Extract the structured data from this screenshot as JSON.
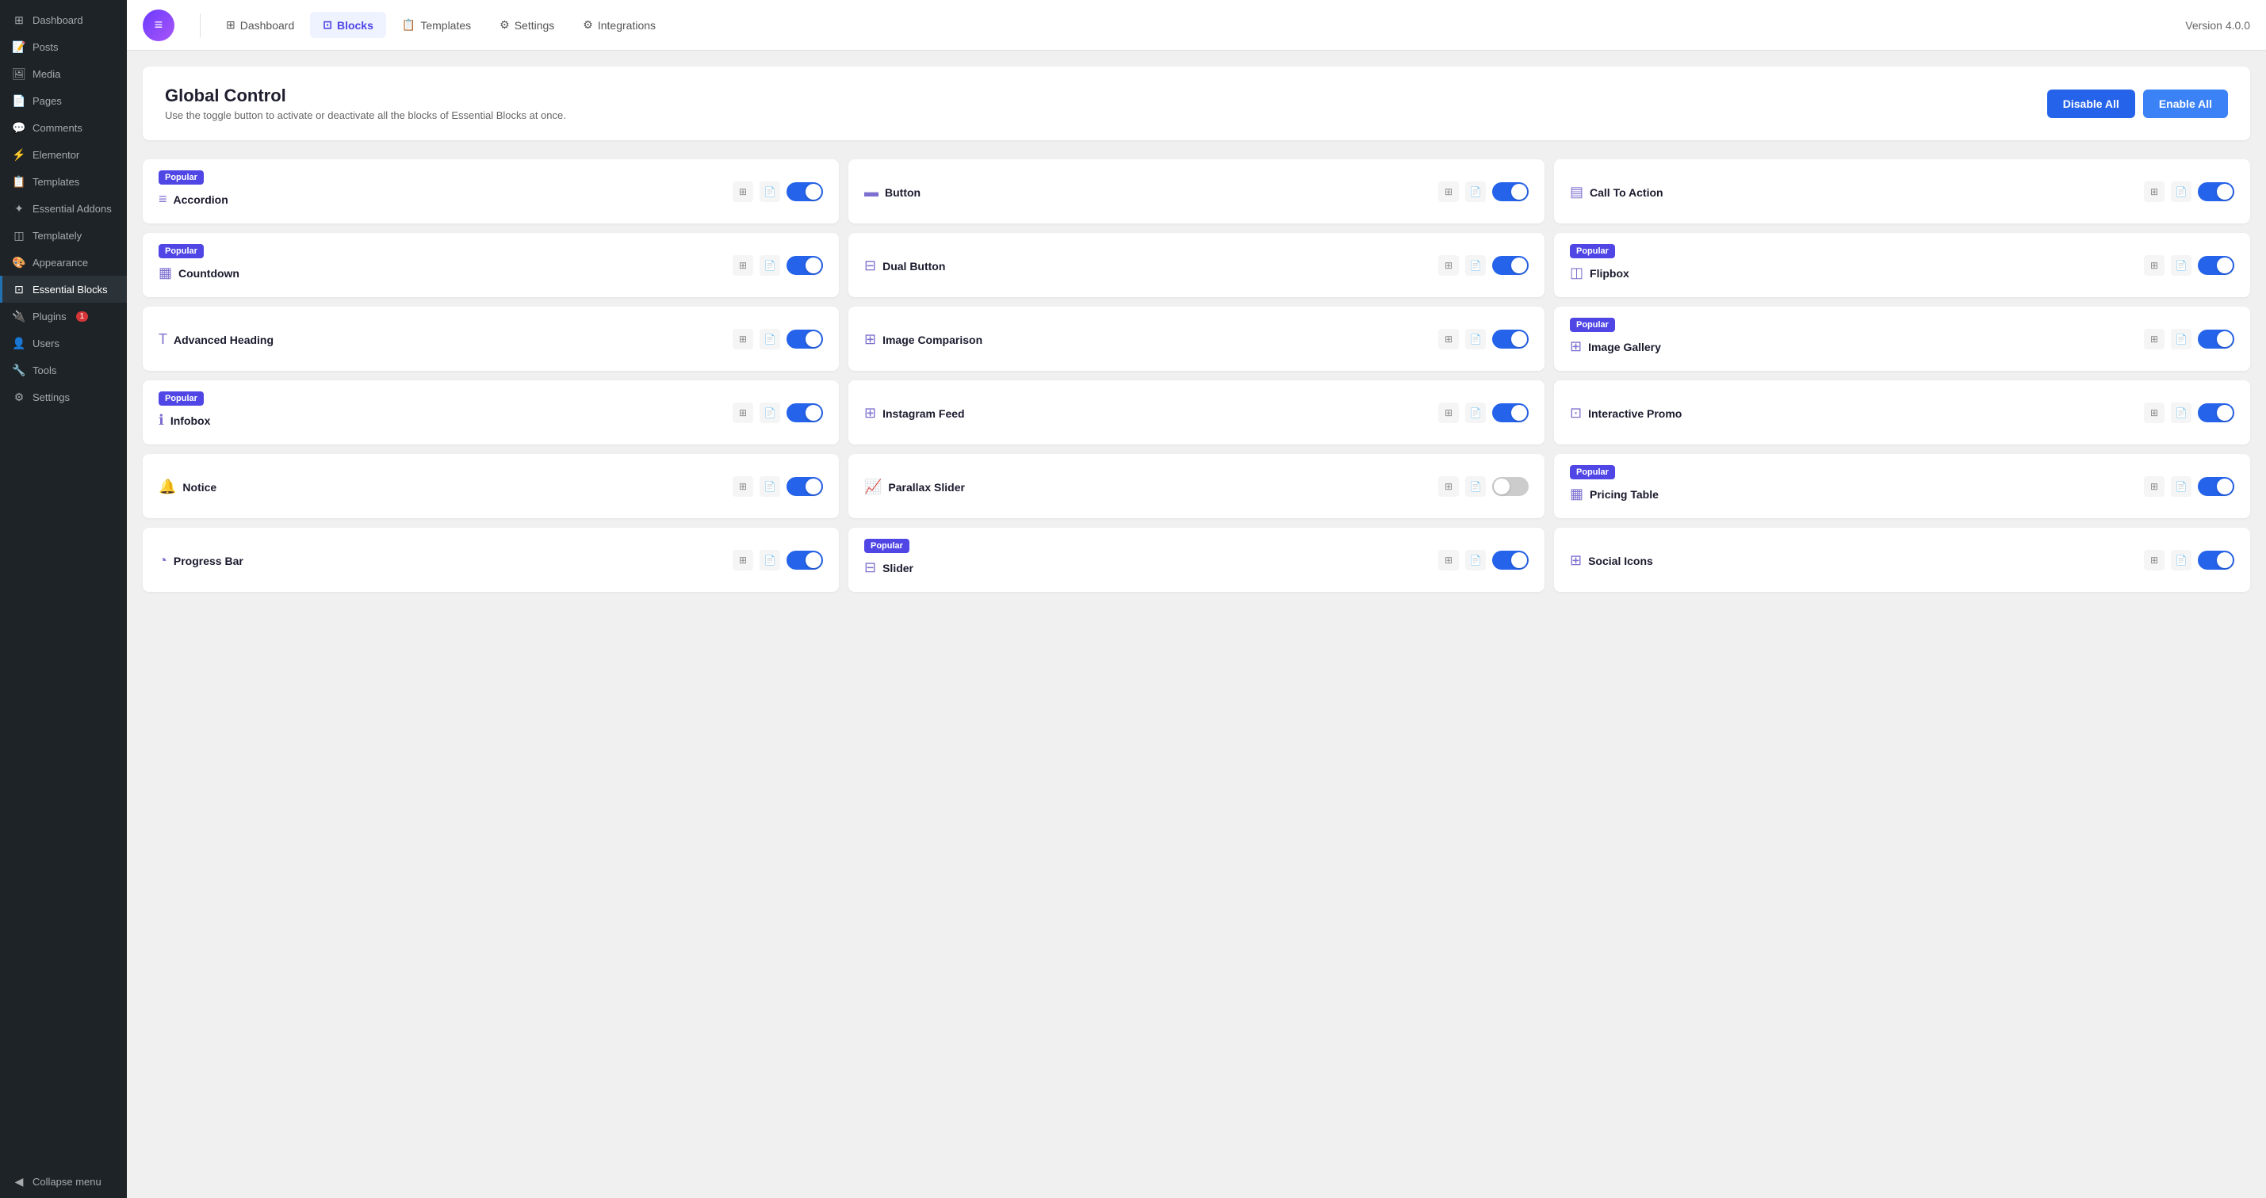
{
  "sidebar": {
    "items": [
      {
        "id": "dashboard",
        "label": "Dashboard",
        "icon": "⊞",
        "active": false
      },
      {
        "id": "posts",
        "label": "Posts",
        "icon": "📝",
        "active": false
      },
      {
        "id": "media",
        "label": "Media",
        "icon": "🖼",
        "active": false
      },
      {
        "id": "pages",
        "label": "Pages",
        "icon": "📄",
        "active": false
      },
      {
        "id": "comments",
        "label": "Comments",
        "icon": "💬",
        "active": false
      },
      {
        "id": "elementor",
        "label": "Elementor",
        "icon": "⚡",
        "active": false
      },
      {
        "id": "templates",
        "label": "Templates",
        "icon": "📋",
        "active": false
      },
      {
        "id": "essential-addons",
        "label": "Essential Addons",
        "icon": "✦",
        "active": false
      },
      {
        "id": "templately",
        "label": "Templately",
        "icon": "◫",
        "active": false
      },
      {
        "id": "appearance",
        "label": "Appearance",
        "icon": "🎨",
        "active": false
      },
      {
        "id": "essential-blocks",
        "label": "Essential Blocks",
        "icon": "⊡",
        "active": true
      },
      {
        "id": "plugins",
        "label": "Plugins",
        "icon": "🔌",
        "active": false,
        "badge": "1"
      },
      {
        "id": "users",
        "label": "Users",
        "icon": "👤",
        "active": false
      },
      {
        "id": "tools",
        "label": "Tools",
        "icon": "🔧",
        "active": false
      },
      {
        "id": "settings",
        "label": "Settings",
        "icon": "⚙",
        "active": false
      }
    ],
    "collapse_label": "Collapse menu"
  },
  "topnav": {
    "logo_icon": "≡",
    "tabs": [
      {
        "id": "dashboard",
        "label": "Dashboard",
        "icon": "⊞",
        "active": false
      },
      {
        "id": "blocks",
        "label": "Blocks",
        "icon": "⊡",
        "active": true
      },
      {
        "id": "templates",
        "label": "Templates",
        "icon": "📋",
        "active": false
      },
      {
        "id": "settings",
        "label": "Settings",
        "icon": "⚙",
        "active": false
      },
      {
        "id": "integrations",
        "label": "Integrations",
        "icon": "⚙",
        "active": false
      }
    ],
    "version": "Version 4.0.0"
  },
  "global_control": {
    "title": "Global Control",
    "description": "Use the toggle button to activate or deactivate all the blocks of Essential Blocks at once.",
    "disable_label": "Disable All",
    "enable_label": "Enable All"
  },
  "blocks": [
    {
      "id": "accordion",
      "name": "Accordion",
      "icon": "≡",
      "popular": true,
      "enabled": true
    },
    {
      "id": "button",
      "name": "Button",
      "icon": "▬",
      "popular": false,
      "enabled": true
    },
    {
      "id": "call-to-action",
      "name": "Call To Action",
      "icon": "▤",
      "popular": false,
      "enabled": true
    },
    {
      "id": "countdown",
      "name": "Countdown",
      "icon": "▦",
      "popular": true,
      "enabled": true
    },
    {
      "id": "dual-button",
      "name": "Dual Button",
      "icon": "⊟",
      "popular": false,
      "enabled": true
    },
    {
      "id": "flipbox",
      "name": "Flipbox",
      "icon": "◫",
      "popular": true,
      "enabled": true
    },
    {
      "id": "advanced-heading",
      "name": "Advanced Heading",
      "icon": "T",
      "popular": false,
      "enabled": true
    },
    {
      "id": "image-comparison",
      "name": "Image Comparison",
      "icon": "⊞",
      "popular": false,
      "enabled": true
    },
    {
      "id": "image-gallery",
      "name": "Image Gallery",
      "icon": "⊞",
      "popular": true,
      "enabled": true
    },
    {
      "id": "infobox",
      "name": "Infobox",
      "icon": "ℹ",
      "popular": true,
      "enabled": true
    },
    {
      "id": "instagram-feed",
      "name": "Instagram Feed",
      "icon": "⊞",
      "popular": false,
      "enabled": true
    },
    {
      "id": "interactive-promo",
      "name": "Interactive Promo",
      "icon": "⊡",
      "popular": false,
      "enabled": true
    },
    {
      "id": "notice",
      "name": "Notice",
      "icon": "🔔",
      "popular": false,
      "enabled": true
    },
    {
      "id": "parallax-slider",
      "name": "Parallax Slider",
      "icon": "📈",
      "popular": false,
      "enabled": false
    },
    {
      "id": "pricing-table",
      "name": "Pricing Table",
      "icon": "▦",
      "popular": true,
      "enabled": true
    },
    {
      "id": "progress-bar",
      "name": "Progress Bar",
      "icon": "◔",
      "popular": false,
      "enabled": true
    },
    {
      "id": "slider",
      "name": "Slider",
      "icon": "⊟",
      "popular": true,
      "enabled": true
    },
    {
      "id": "social-icons",
      "name": "Social Icons",
      "icon": "⊞",
      "popular": false,
      "enabled": true
    }
  ],
  "popular_label": "Popular"
}
